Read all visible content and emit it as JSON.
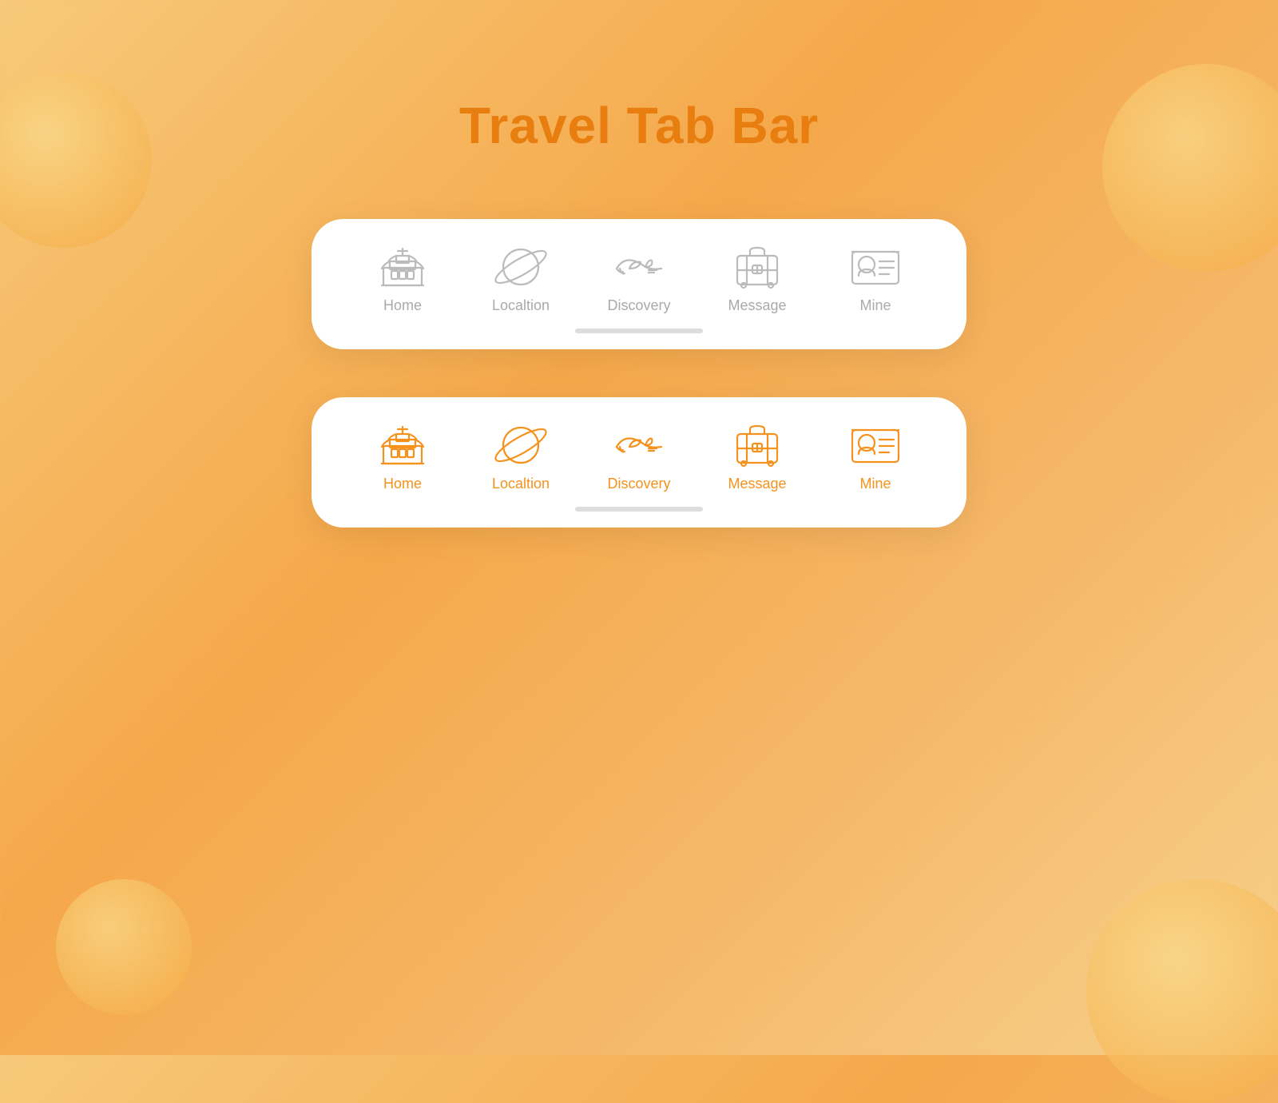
{
  "page": {
    "title": "Travel Tab Bar",
    "title_color": "#e87d10",
    "background_gradient_start": "#f7c97a",
    "background_gradient_end": "#f5a84a"
  },
  "tab_bars": [
    {
      "id": "inactive-bar",
      "state": "inactive",
      "tabs": [
        {
          "id": "home",
          "label": "Home",
          "icon": "temple-icon"
        },
        {
          "id": "location",
          "label": "Localtion",
          "icon": "planet-icon"
        },
        {
          "id": "discovery",
          "label": "Discovery",
          "icon": "airplane-icon"
        },
        {
          "id": "message",
          "label": "Message",
          "icon": "luggage-icon"
        },
        {
          "id": "mine",
          "label": "Mine",
          "icon": "profile-icon"
        }
      ]
    },
    {
      "id": "active-bar",
      "state": "active",
      "tabs": [
        {
          "id": "home",
          "label": "Home",
          "icon": "temple-icon"
        },
        {
          "id": "location",
          "label": "Localtion",
          "icon": "planet-icon"
        },
        {
          "id": "discovery",
          "label": "Discovery",
          "icon": "airplane-icon"
        },
        {
          "id": "message",
          "label": "Message",
          "icon": "luggage-icon"
        },
        {
          "id": "mine",
          "label": "Mine",
          "icon": "profile-icon"
        }
      ]
    }
  ]
}
